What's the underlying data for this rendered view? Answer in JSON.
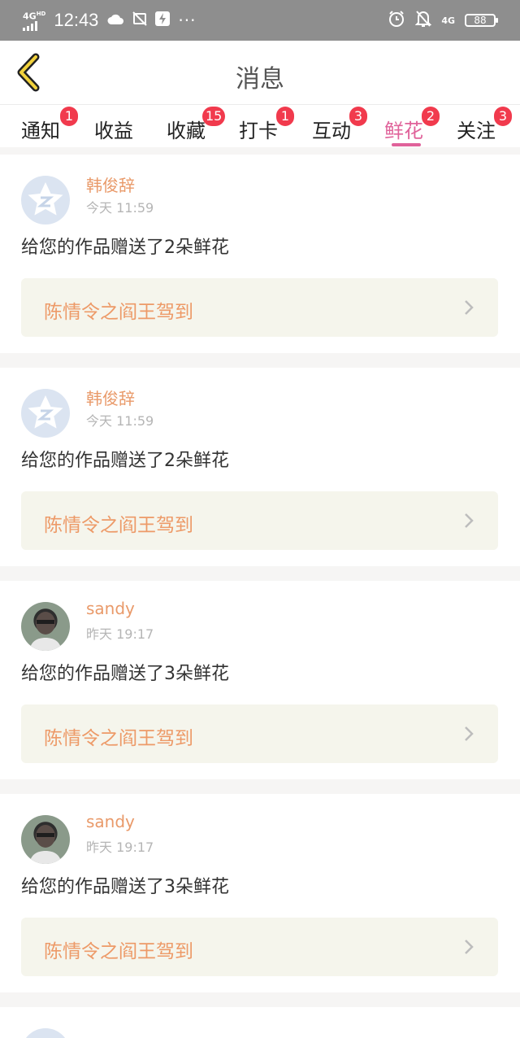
{
  "status_bar": {
    "network": "4G",
    "network_sup": "HD",
    "time": "12:43",
    "icons": [
      "cloud-icon",
      "photo-off-icon",
      "flash-icon"
    ],
    "more": "···",
    "right_net": "4G",
    "battery": "88"
  },
  "header": {
    "title": "消息",
    "back_icon": "chevron-left-icon"
  },
  "tabs": [
    {
      "label": "通知",
      "badge": "1"
    },
    {
      "label": "收益",
      "badge": ""
    },
    {
      "label": "收藏",
      "badge": "15"
    },
    {
      "label": "打卡",
      "badge": "1"
    },
    {
      "label": "互动",
      "badge": "3"
    },
    {
      "label": "鲜花",
      "badge": "2",
      "active": true
    },
    {
      "label": "关注",
      "badge": "3"
    }
  ],
  "colors": {
    "accent_pink": "#e0629a",
    "badge_red": "#f13a4d",
    "name_orange": "#e99a6a",
    "work_bg": "#f5f5ec"
  },
  "messages": [
    {
      "user": "韩俊辞",
      "time": "今天 11:59",
      "text": "给您的作品赠送了2朵鲜花",
      "work": "陈情令之阎王驾到",
      "avatar": "default-star-avatar"
    },
    {
      "user": "韩俊辞",
      "time": "今天 11:59",
      "text": "给您的作品赠送了2朵鲜花",
      "work": "陈情令之阎王驾到",
      "avatar": "default-star-avatar"
    },
    {
      "user": "sandy",
      "time": "昨天 19:17",
      "text": "给您的作品赠送了3朵鲜花",
      "work": "陈情令之阎王驾到",
      "avatar": "photo-avatar"
    },
    {
      "user": "sandy",
      "time": "昨天 19:17",
      "text": "给您的作品赠送了3朵鲜花",
      "work": "陈情令之阎王驾到",
      "avatar": "photo-avatar"
    }
  ]
}
